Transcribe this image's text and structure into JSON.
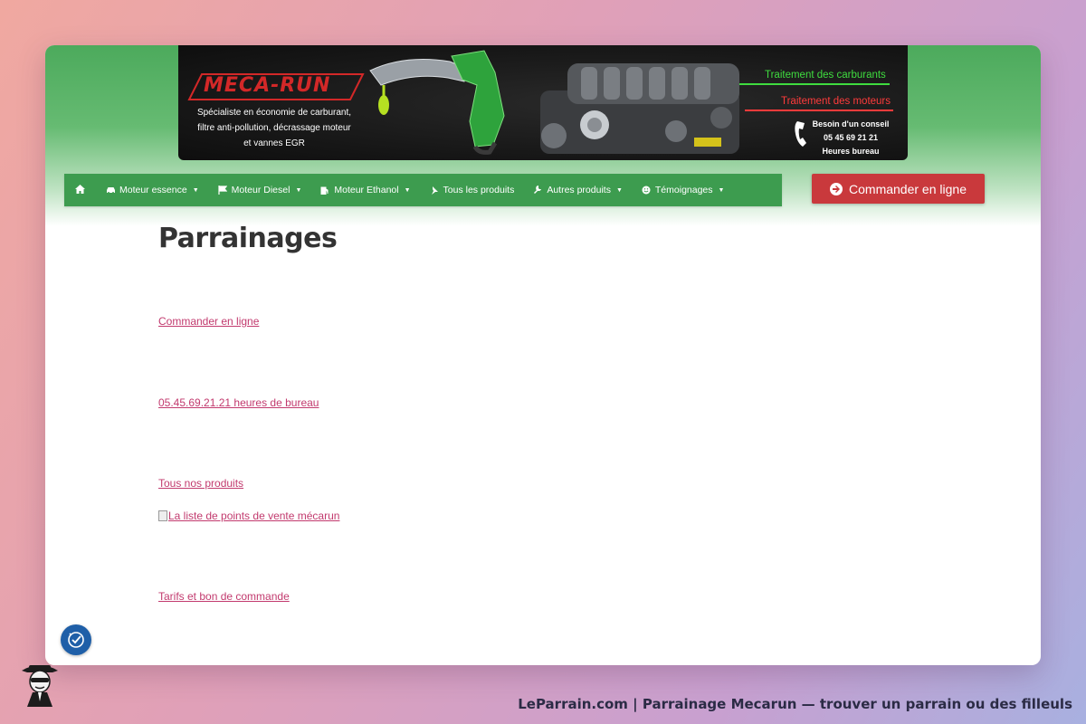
{
  "banner": {
    "logo": "MECA-RUN",
    "tagline_lines": [
      "Spécialiste en économie de carburant,",
      "filtre anti-pollution, décrassage moteur",
      "et vannes EGR"
    ],
    "tag_fuel": "Traitement des carburants",
    "tag_engine": "Traitement des moteurs",
    "advice_title": "Besoin d'un conseil",
    "advice_phone": "05 45 69 21 21",
    "advice_hours": "Heures bureau"
  },
  "nav": {
    "items": [
      {
        "label": "Moteur essence",
        "icon": "car-icon",
        "dropdown": true
      },
      {
        "label": "Moteur Diesel",
        "icon": "flag-icon",
        "dropdown": true
      },
      {
        "label": "Moteur Ethanol",
        "icon": "fuel-pump-icon",
        "dropdown": true
      },
      {
        "label": "Tous les produits",
        "icon": "pin-icon",
        "dropdown": false
      },
      {
        "label": "Autres produits",
        "icon": "wrench-icon",
        "dropdown": true
      },
      {
        "label": "Témoignages",
        "icon": "smile-icon",
        "dropdown": true
      }
    ]
  },
  "order_button": {
    "label": "Commander en ligne"
  },
  "page": {
    "title": "Parrainages",
    "links": {
      "order": "Commander en ligne",
      "phone": "05.45.69.21.21 heures de bureau",
      "products": "Tous nos produits",
      "points_of_sale": "La liste de points de vente mécarun",
      "pricing": "Tarifs et bon de commande"
    }
  },
  "footer": {
    "caption": "LeParrain.com | Parrainage Mecarun — trouver un parrain ou des filleuls"
  },
  "colors": {
    "nav_green": "#3d9c4f",
    "order_red": "#c9393c",
    "link_pink": "#c23a6e",
    "a11y_blue": "#1f5fa8"
  }
}
